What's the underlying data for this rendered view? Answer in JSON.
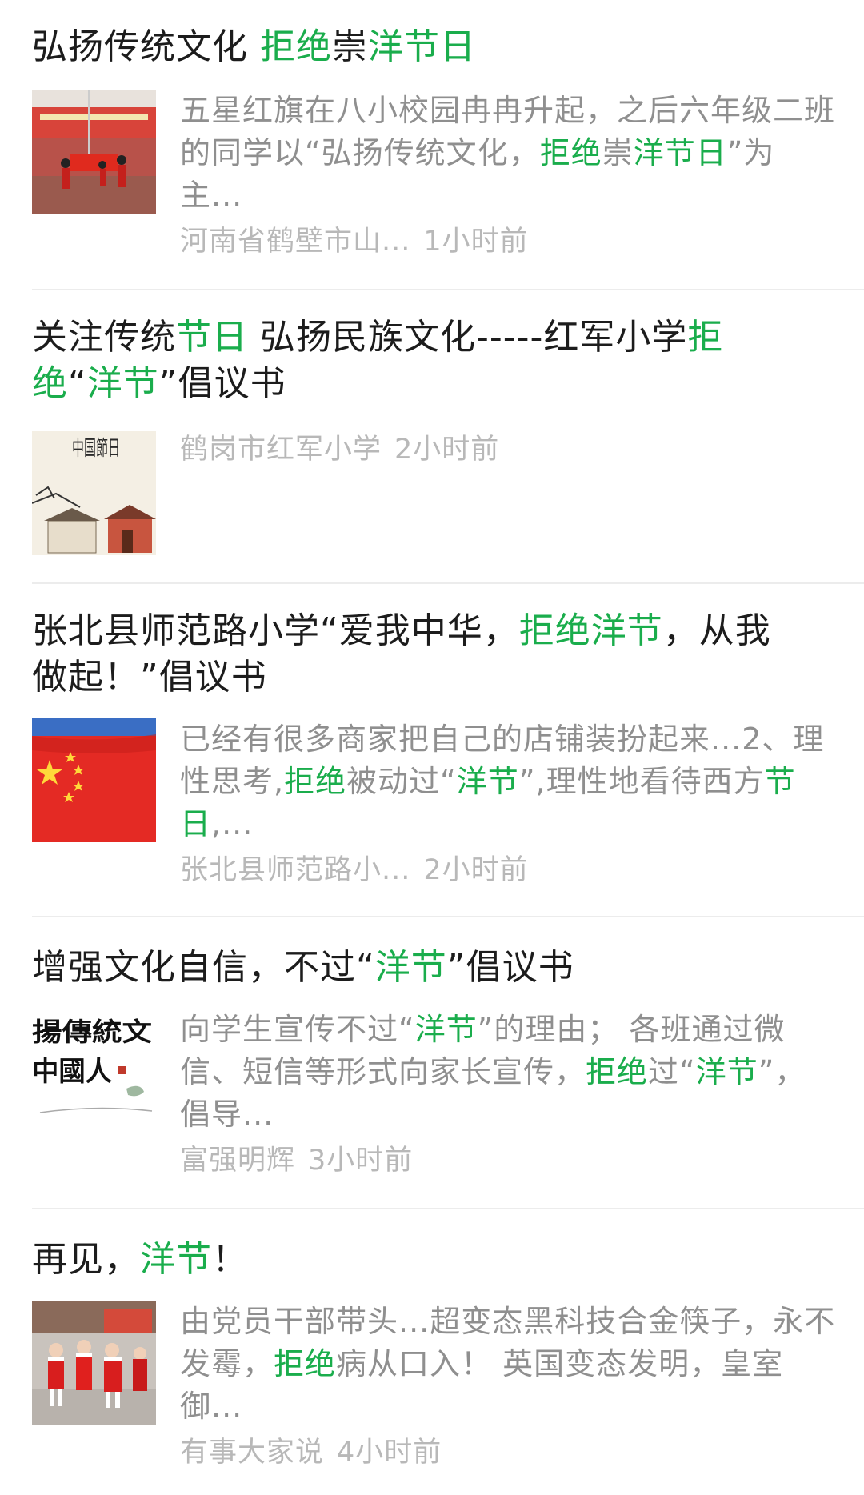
{
  "articles": [
    {
      "title_segments": [
        {
          "text": "弘扬传统文化 ",
          "hl": false
        },
        {
          "text": "拒绝",
          "hl": true
        },
        {
          "text": "崇",
          "hl": false
        },
        {
          "text": "洋节日",
          "hl": true
        }
      ],
      "desc_segments": [
        {
          "text": "五星红旗在八小校园冉冉升起，之后六年级二班的同学以“弘扬传统文化，",
          "hl": false
        },
        {
          "text": "拒绝",
          "hl": true
        },
        {
          "text": "崇",
          "hl": false
        },
        {
          "text": "洋节日",
          "hl": true
        },
        {
          "text": "”为主...",
          "hl": false
        }
      ],
      "source": "河南省鹤壁市山...",
      "time": "1小时前",
      "thumbnail": "flag-raising-photo"
    },
    {
      "title_segments": [
        {
          "text": "关注传统",
          "hl": false
        },
        {
          "text": "节日",
          "hl": true
        },
        {
          "text": " 弘扬民族文化-----红军小学",
          "hl": false
        },
        {
          "text": "拒绝",
          "hl": true
        },
        {
          "text": "“",
          "hl": false
        },
        {
          "text": "洋节",
          "hl": true
        },
        {
          "text": "”倡议书",
          "hl": false
        }
      ],
      "desc_segments": [],
      "source": "鹤岗市红军小学",
      "time": "2小时前",
      "thumbnail": "chinese-festival-illustration",
      "thumb_text": "中国節日"
    },
    {
      "title_segments": [
        {
          "text": "张北县师范路小学“爱我中华，",
          "hl": false
        },
        {
          "text": "拒绝洋节",
          "hl": true
        },
        {
          "text": "，从我做起！”倡议书",
          "hl": false
        }
      ],
      "desc_segments": [
        {
          "text": "已经有很多商家把自己的店铺装扮起来...2、理性思考,",
          "hl": false
        },
        {
          "text": "拒绝",
          "hl": true
        },
        {
          "text": "被动过“",
          "hl": false
        },
        {
          "text": "洋节",
          "hl": true
        },
        {
          "text": "”,理性地看待西方",
          "hl": false
        },
        {
          "text": "节日",
          "hl": true
        },
        {
          "text": ",...",
          "hl": false
        }
      ],
      "source": "张北县师范路小...",
      "time": "2小时前",
      "thumbnail": "national-flag-photo"
    },
    {
      "title_segments": [
        {
          "text": "增强文化自信，不过“",
          "hl": false
        },
        {
          "text": "洋节",
          "hl": true
        },
        {
          "text": "”倡议书",
          "hl": false
        }
      ],
      "desc_segments": [
        {
          "text": "向学生宣传不过“",
          "hl": false
        },
        {
          "text": "洋节",
          "hl": true
        },
        {
          "text": "”的理由； 各班通过微信、短信等形式向家长宣传，",
          "hl": false
        },
        {
          "text": "拒绝",
          "hl": true
        },
        {
          "text": "过“",
          "hl": false
        },
        {
          "text": "洋节",
          "hl": true
        },
        {
          "text": "”，倡导...",
          "hl": false
        }
      ],
      "source": "富强明辉",
      "time": "3小时前",
      "thumbnail": "calligraphy-image",
      "thumb_text": [
        "揚傳統文",
        "中國人"
      ]
    },
    {
      "title_segments": [
        {
          "text": "再见，",
          "hl": false
        },
        {
          "text": "洋节",
          "hl": true
        },
        {
          "text": "！",
          "hl": false
        }
      ],
      "desc_segments": [
        {
          "text": "由党员干部带头...超变态黑科技合金筷子，永不发霉，",
          "hl": false
        },
        {
          "text": "拒绝",
          "hl": true
        },
        {
          "text": "病从口入！ 英国变态发明，皇室御...",
          "hl": false
        }
      ],
      "source": "有事大家说",
      "time": "4小时前",
      "thumbnail": "santa-costume-photo"
    }
  ],
  "colors": {
    "highlight": "#1aad4c",
    "title": "#1c1c1c",
    "desc": "#8f8f8f",
    "meta": "#b8b8b8"
  }
}
